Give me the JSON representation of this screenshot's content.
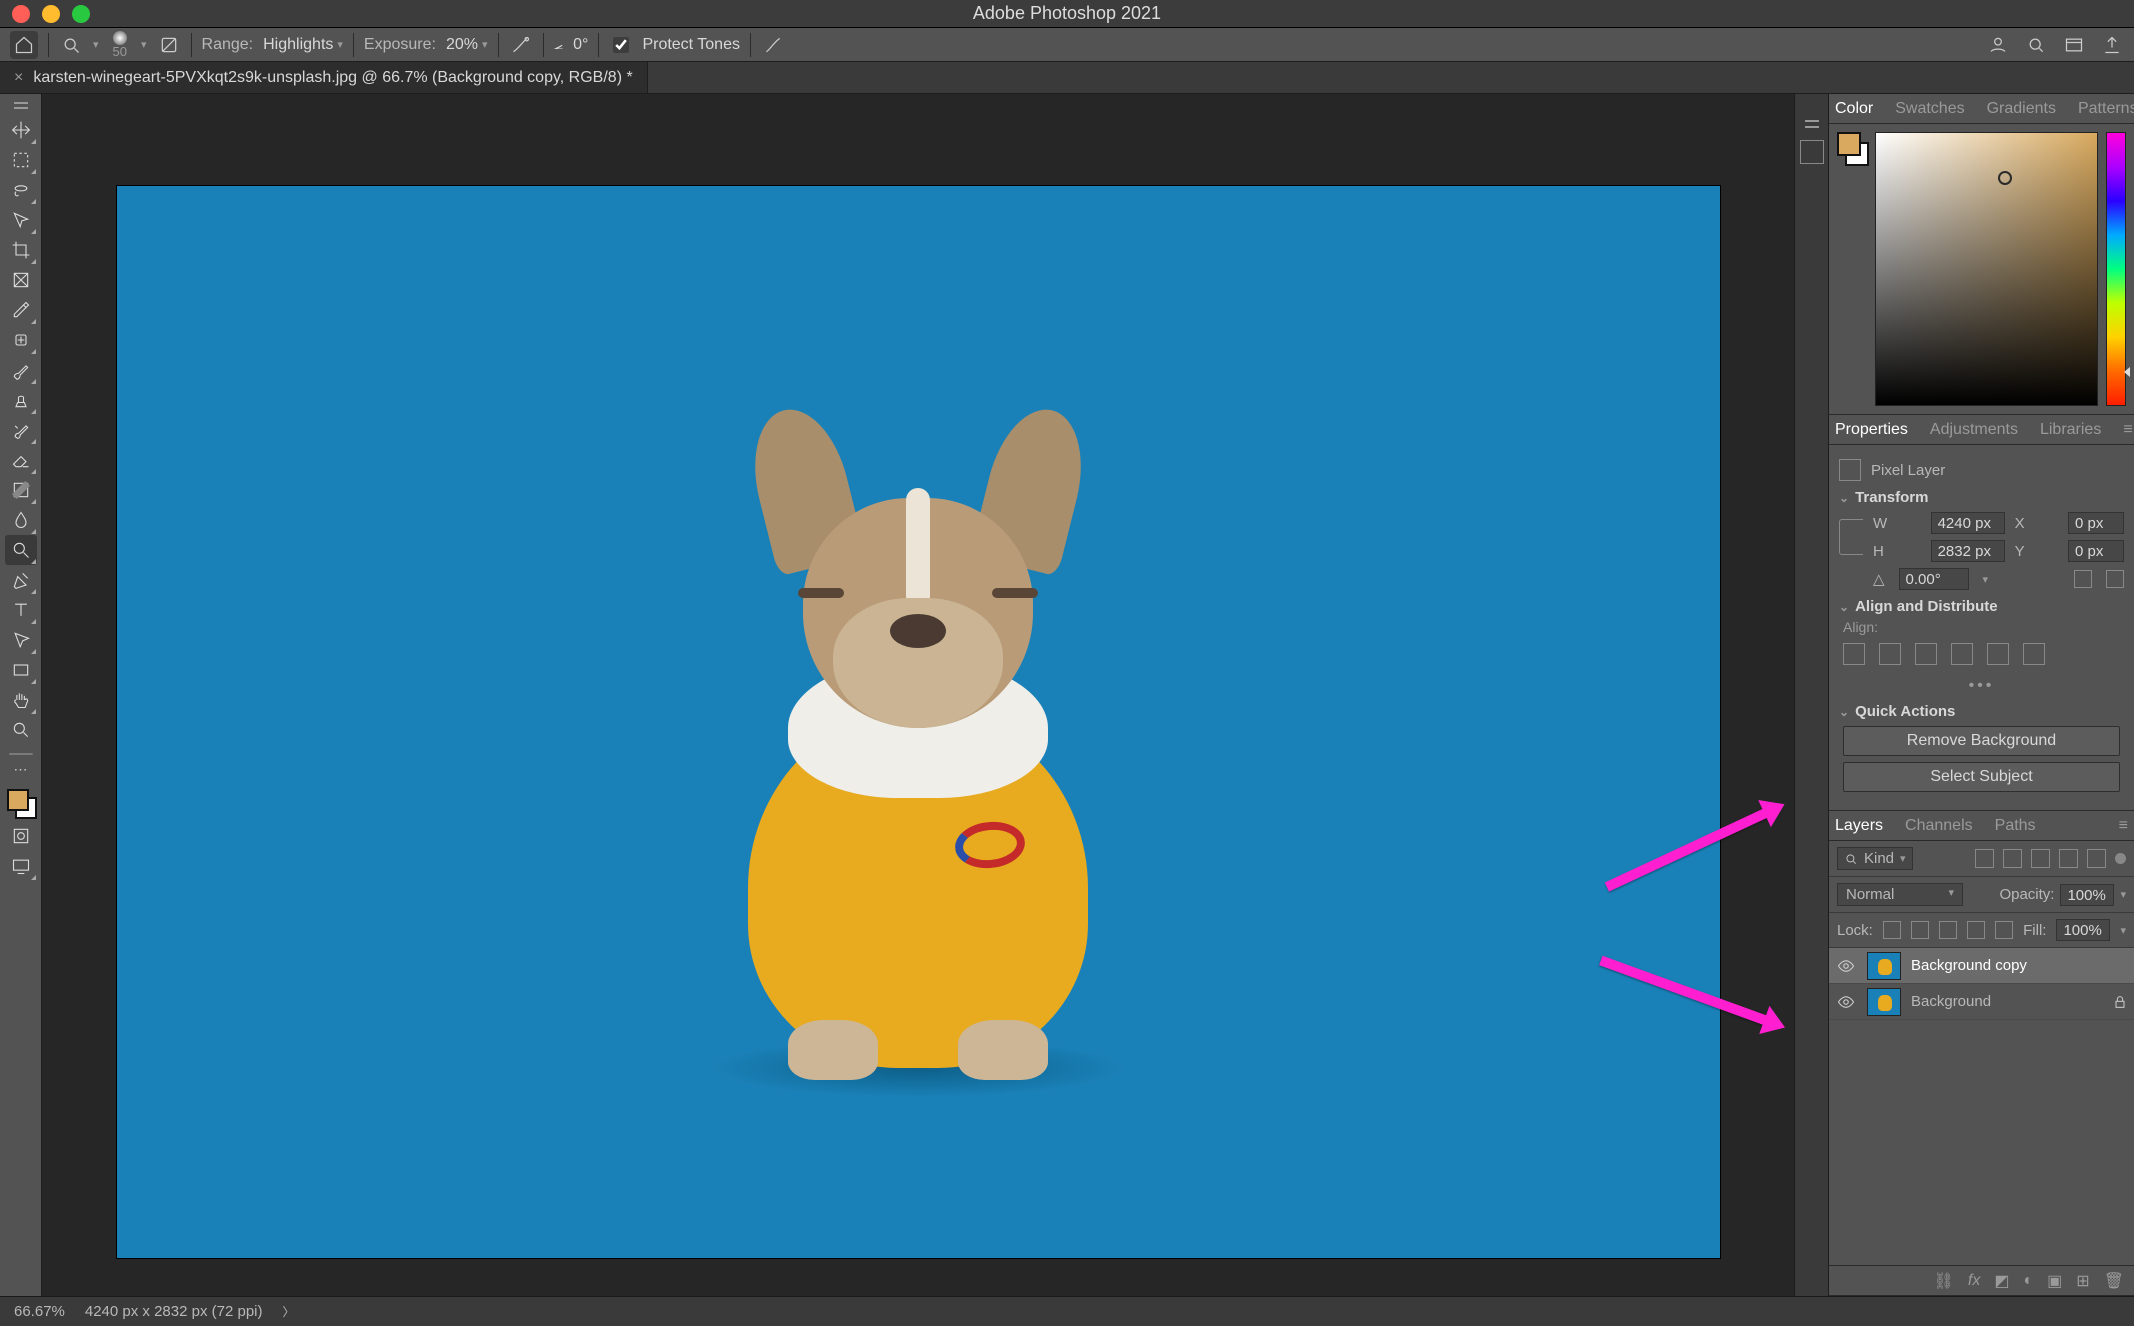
{
  "app": {
    "title": "Adobe Photoshop 2021"
  },
  "optionbar": {
    "brush_size": "50",
    "range_label": "Range:",
    "range_value": "Highlights",
    "exposure_label": "Exposure:",
    "exposure_value": "20%",
    "angle_label": "",
    "angle_value": "0°",
    "protect_tones_label": "Protect Tones",
    "protect_tones_checked": true
  },
  "doc": {
    "tab_title": "karsten-winegeart-5PVXkqt2s9k-unsplash.jpg @ 66.7% (Background copy, RGB/8) *"
  },
  "colorpanel": {
    "tabs": [
      "Color",
      "Swatches",
      "Gradients",
      "Patterns"
    ],
    "active_tab": 0,
    "foreground": "#d8a95e",
    "background": "#ffffff",
    "cursor": {
      "x_pct": 55,
      "y_pct": 14
    },
    "hue_marker_pct": 86
  },
  "propspanel": {
    "tabs": [
      "Properties",
      "Adjustments",
      "Libraries"
    ],
    "active_tab": 0,
    "layer_type": "Pixel Layer",
    "transform_label": "Transform",
    "W_label": "W",
    "W": "4240 px",
    "H_label": "H",
    "H": "2832 px",
    "X_label": "X",
    "X": "0 px",
    "Y_label": "Y",
    "Y": "0 px",
    "angle_icon": "△",
    "angle": "0.00°",
    "align_label": "Align and Distribute",
    "align_sub": "Align:",
    "quick_label": "Quick Actions",
    "qa_remove": "Remove Background",
    "qa_select": "Select Subject"
  },
  "layerspanel": {
    "tabs": [
      "Layers",
      "Channels",
      "Paths"
    ],
    "active_tab": 0,
    "kind_label": "Kind",
    "blend_mode": "Normal",
    "opacity_label": "Opacity:",
    "opacity": "100%",
    "lock_label": "Lock:",
    "fill_label": "Fill:",
    "fill": "100%",
    "layers": [
      {
        "name": "Background copy",
        "selected": true,
        "visible": true,
        "locked": false
      },
      {
        "name": "Background",
        "selected": false,
        "visible": true,
        "locked": true
      }
    ]
  },
  "status": {
    "zoom": "66.67%",
    "dims": "4240 px x 2832 px (72 ppi)"
  },
  "tools": [
    "move-tool",
    "rect-marquee-tool",
    "lasso-tool",
    "object-select-tool",
    "crop-tool",
    "frame-tool",
    "eyedropper-tool",
    "healing-brush-tool",
    "brush-tool",
    "clone-stamp-tool",
    "history-brush-tool",
    "eraser-tool",
    "gradient-tool",
    "blur-tool",
    "dodge-tool",
    "pen-tool",
    "type-tool",
    "path-select-tool",
    "rectangle-tool",
    "hand-tool",
    "zoom-tool"
  ],
  "tool_selected_index": 14
}
